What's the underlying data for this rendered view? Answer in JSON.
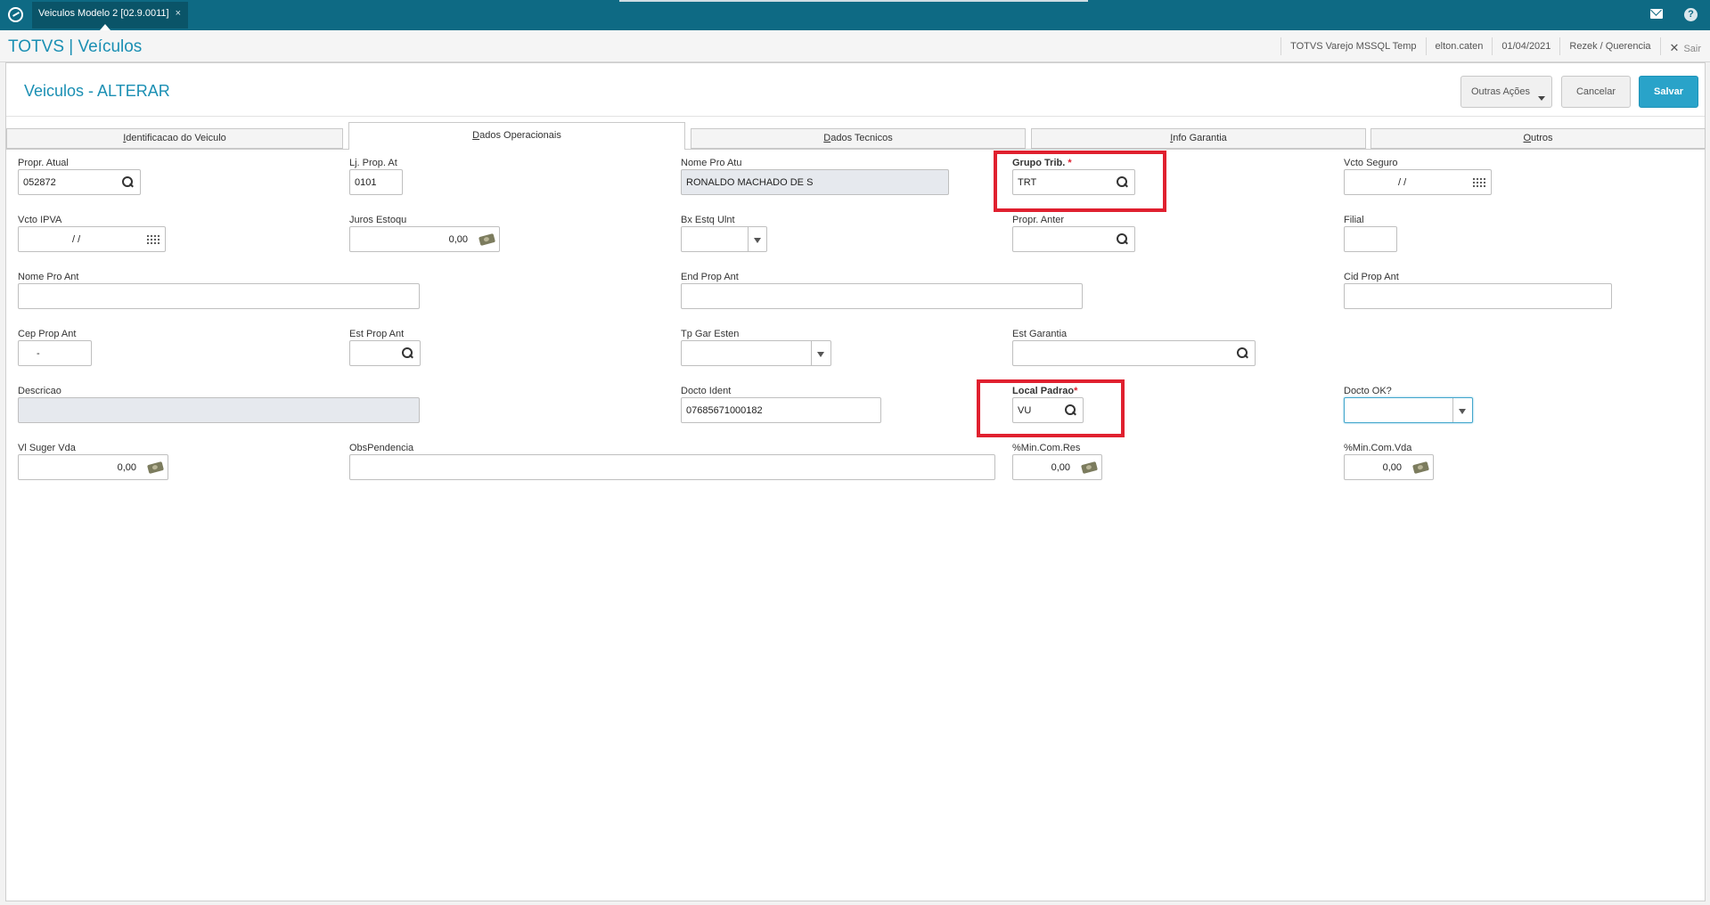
{
  "topbar": {
    "tab_title": "Veiculos Modelo 2 [02.9.0011]",
    "tab_close": "×",
    "icons": [
      "mail-icon",
      "help-icon"
    ],
    "help_glyph": "?"
  },
  "header": {
    "brand": "TOTVS | Veículos",
    "environment": "TOTVS Varejo MSSQL Temp",
    "user": "elton.caten",
    "date": "01/04/2021",
    "branch": "Rezek / Querencia",
    "exit_label": "Sair",
    "exit_glyph": "✕"
  },
  "page": {
    "title": "Veiculos - ALTERAR",
    "actions": {
      "more": "Outras Ações",
      "cancel": "Cancelar",
      "save": "Salvar"
    }
  },
  "tabs": [
    {
      "label": "Identificacao do Veiculo",
      "hotkey": "I",
      "rest": "dentificacao do Veiculo",
      "active": false
    },
    {
      "label": "Dados Operacionais",
      "hotkey": "D",
      "rest": "ados Operacionais",
      "active": true
    },
    {
      "label": "Dados Tecnicos",
      "hotkey": "D",
      "rest": "ados Tecnicos",
      "active": false
    },
    {
      "label": "Info Garantia",
      "hotkey": "I",
      "rest": "nfo Garantia",
      "active": false
    },
    {
      "label": "Outros",
      "hotkey": "O",
      "rest": "utros",
      "active": false
    }
  ],
  "form": {
    "propr_atual": {
      "label": "Propr. Atual",
      "value": "052872"
    },
    "lj_prop_at": {
      "label": "Lj. Prop. At",
      "value": "0101"
    },
    "nome_pro_atu": {
      "label": "Nome Pro Atu",
      "value": "RONALDO MACHADO DE S"
    },
    "grupo_trib": {
      "label": "Grupo Trib.",
      "required": "*",
      "value": "TRT"
    },
    "vcto_seguro": {
      "label": "Vcto Seguro",
      "value": "/ /"
    },
    "vcto_ipva": {
      "label": "Vcto IPVA",
      "value": "/ /"
    },
    "juros_estoqu": {
      "label": "Juros Estoqu",
      "value": "0,00"
    },
    "bx_estq_ulnt": {
      "label": "Bx Estq Ulnt",
      "value": ""
    },
    "propr_anter": {
      "label": "Propr. Anter",
      "value": ""
    },
    "filial": {
      "label": "Filial",
      "value": ""
    },
    "nome_pro_ant": {
      "label": "Nome Pro Ant",
      "value": ""
    },
    "end_prop_ant": {
      "label": "End Prop Ant",
      "value": ""
    },
    "cid_prop_ant": {
      "label": "Cid Prop Ant",
      "value": ""
    },
    "cep_prop_ant": {
      "label": "Cep Prop Ant",
      "value": "-"
    },
    "est_prop_ant": {
      "label": "Est Prop Ant",
      "value": ""
    },
    "tp_gar_esten": {
      "label": "Tp Gar Esten",
      "value": ""
    },
    "est_garantia": {
      "label": "Est Garantia",
      "value": ""
    },
    "descricao": {
      "label": "Descricao",
      "value": ""
    },
    "docto_ident": {
      "label": "Docto Ident",
      "value": "07685671000182"
    },
    "local_padrao": {
      "label": "Local Padrao",
      "required": "*",
      "value": "VU"
    },
    "docto_ok": {
      "label": "Docto OK?",
      "value": ""
    },
    "vl_suger_vda": {
      "label": "Vl Suger Vda",
      "value": "0,00"
    },
    "obs_pendencia": {
      "label": "ObsPendencia",
      "value": ""
    },
    "min_com_res": {
      "label": "%Min.Com.Res",
      "value": "0,00"
    },
    "min_com_vda": {
      "label": "%Min.Com.Vda",
      "value": "0,00"
    }
  },
  "highlights": {
    "color": "#e0202f",
    "fields": [
      "grupo_trib",
      "local_padrao"
    ]
  },
  "colors": {
    "topbar": "#0e6a84",
    "brand": "#1a8fb3",
    "primary_button": "#29a3c9",
    "required": "#e0202f"
  }
}
